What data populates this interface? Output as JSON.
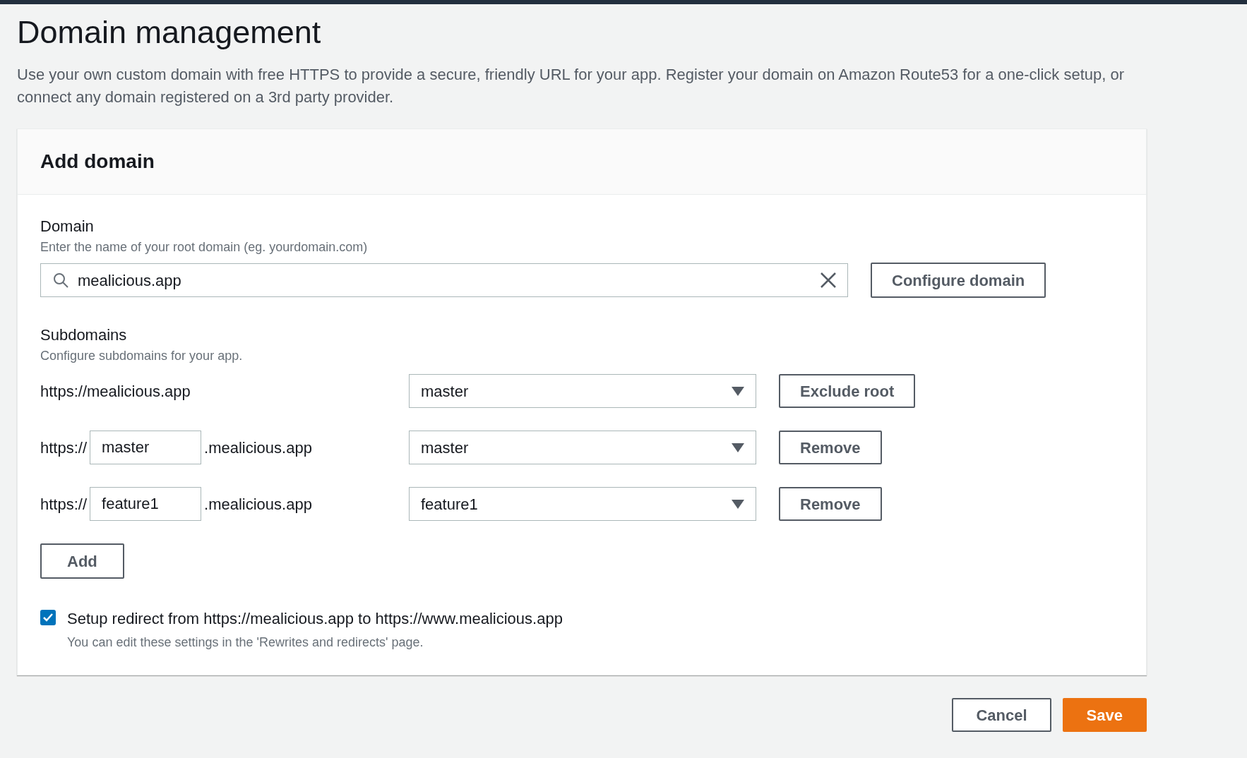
{
  "page": {
    "title": "Domain management",
    "description": "Use your own custom domain with free HTTPS to provide a secure, friendly URL for your app. Register your domain on Amazon Route53 for a one-click setup, or connect any domain registered on a 3rd party provider."
  },
  "card": {
    "title": "Add domain"
  },
  "domain": {
    "label": "Domain",
    "hint": "Enter the name of your root domain (eg. yourdomain.com)",
    "value": "mealicious.app"
  },
  "configure_button": "Configure domain",
  "subdomains": {
    "label": "Subdomains",
    "hint": "Configure subdomains for your app.",
    "rows": [
      {
        "kind": "root",
        "url": "https://mealicious.app",
        "branch": "master",
        "action": "Exclude root"
      },
      {
        "kind": "prefixed",
        "prefix": "https://",
        "subdomain": "master",
        "suffix": ".mealicious.app",
        "branch": "master",
        "action": "Remove"
      },
      {
        "kind": "prefixed",
        "prefix": "https://",
        "subdomain": "feature1",
        "suffix": ".mealicious.app",
        "branch": "feature1",
        "action": "Remove"
      }
    ]
  },
  "add_button": "Add",
  "redirect": {
    "checked": true,
    "label": "Setup redirect from https://mealicious.app to https://www.mealicious.app",
    "note": "You can edit these settings in the 'Rewrites and redirects' page."
  },
  "buttons": [
    {
      "kind": "secondary",
      "label": "Cancel"
    },
    {
      "kind": "primary",
      "label": "Save"
    }
  ]
}
